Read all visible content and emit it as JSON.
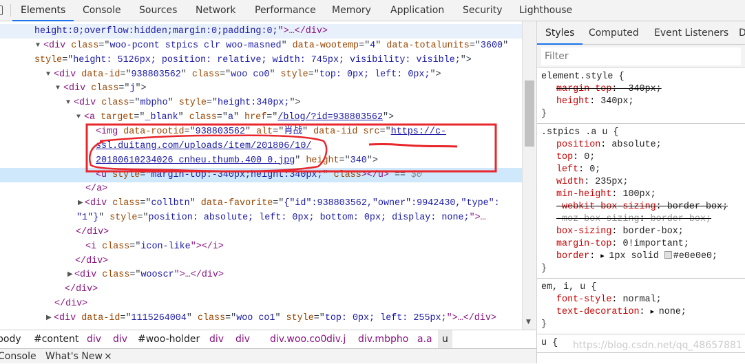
{
  "toolbar": {
    "tabs": [
      "Elements",
      "Console",
      "Sources",
      "Network",
      "Performance",
      "Memory",
      "Application",
      "Security",
      "Lighthouse"
    ],
    "active": "Elements"
  },
  "dom_lines": [
    {
      "tokens": [
        [
          "v",
          "height:0;overflow:hidden;margin:0;padding:0;"
        ],
        [
          "t",
          "\">…</div>"
        ]
      ]
    },
    {
      "tokens": [
        [
          "t",
          "<div "
        ],
        [
          "a",
          "class"
        ],
        [
          "p",
          "=\""
        ],
        [
          "v",
          "woo-pcont stpics clr woo-masned"
        ],
        [
          "p",
          "\" "
        ],
        [
          "a",
          "data-wootemp"
        ],
        [
          "p",
          "=\""
        ],
        [
          "v",
          "4"
        ],
        [
          "p",
          "\" "
        ],
        [
          "a",
          "data-totalunits"
        ],
        [
          "p",
          "=\""
        ],
        [
          "v",
          "3600"
        ],
        [
          "p",
          "\""
        ]
      ]
    },
    {
      "tokens": [
        [
          "a",
          "style"
        ],
        [
          "p",
          "=\""
        ],
        [
          "v",
          "height: 5126px; position: relative; width: 745px; visibility: visible;"
        ],
        [
          "p",
          "\">"
        ]
      ]
    },
    {
      "tokens": [
        [
          "t",
          "<div "
        ],
        [
          "a",
          "data-id"
        ],
        [
          "p",
          "=\""
        ],
        [
          "v",
          "938803562"
        ],
        [
          "p",
          "\" "
        ],
        [
          "a",
          "class"
        ],
        [
          "p",
          "=\""
        ],
        [
          "v",
          "woo co0"
        ],
        [
          "p",
          "\" "
        ],
        [
          "a",
          "style"
        ],
        [
          "p",
          "=\""
        ],
        [
          "v",
          "top: 0px; left: 0px;"
        ],
        [
          "p",
          "\">"
        ]
      ]
    },
    {
      "tokens": [
        [
          "t",
          "<div "
        ],
        [
          "a",
          "class"
        ],
        [
          "p",
          "=\""
        ],
        [
          "v",
          "j"
        ],
        [
          "p",
          "\">"
        ]
      ]
    },
    {
      "tokens": [
        [
          "t",
          "<div "
        ],
        [
          "a",
          "class"
        ],
        [
          "p",
          "=\""
        ],
        [
          "v",
          "mbpho"
        ],
        [
          "p",
          "\" "
        ],
        [
          "a",
          "style"
        ],
        [
          "p",
          "=\""
        ],
        [
          "v",
          "height:340px;"
        ],
        [
          "p",
          "\">"
        ]
      ]
    },
    {
      "tokens": [
        [
          "t",
          "<a "
        ],
        [
          "a",
          "target"
        ],
        [
          "p",
          "=\""
        ],
        [
          "v",
          "_blank"
        ],
        [
          "p",
          "\" "
        ],
        [
          "a",
          "class"
        ],
        [
          "p",
          "=\""
        ],
        [
          "v",
          "a"
        ],
        [
          "p",
          "\" "
        ],
        [
          "a",
          "href"
        ],
        [
          "p",
          "=\""
        ],
        [
          "l",
          "/blog/?id=938803562"
        ],
        [
          "p",
          "\">"
        ]
      ]
    },
    {
      "tokens": [
        [
          "t",
          "<img "
        ],
        [
          "a",
          "data-rootid"
        ],
        [
          "p",
          "=\""
        ],
        [
          "v",
          "938803562"
        ],
        [
          "p",
          "\" "
        ],
        [
          "a",
          "alt"
        ],
        [
          "p",
          "=\""
        ],
        [
          "v",
          "肖战"
        ],
        [
          "p",
          "\" "
        ],
        [
          "a",
          "data-iid"
        ],
        [
          "p",
          " "
        ],
        [
          "a",
          "src"
        ],
        [
          "p",
          "=\""
        ],
        [
          "l",
          "https://c-"
        ]
      ]
    },
    {
      "tokens": [
        [
          "l",
          "ssl.duitang.com/uploads/item/201806/10/"
        ]
      ]
    },
    {
      "tokens": [
        [
          "l",
          "20180610234026_cnheu.thumb.400_0.jpg"
        ],
        [
          "p",
          "\" "
        ],
        [
          "a",
          "height"
        ],
        [
          "p",
          "=\""
        ],
        [
          "v",
          "340"
        ],
        [
          "p",
          "\">"
        ]
      ]
    },
    {
      "tokens": [
        [
          "t",
          "<u "
        ],
        [
          "a",
          "style"
        ],
        [
          "p",
          "=\""
        ],
        [
          "v",
          "margin-top:-340px;height:340px;"
        ],
        [
          "p",
          "\" "
        ],
        [
          "a",
          "class"
        ],
        [
          "t",
          "></u>"
        ],
        [
          "p",
          " == "
        ],
        [
          "g",
          "$0"
        ]
      ]
    },
    {
      "tokens": [
        [
          "t",
          "</a>"
        ]
      ]
    },
    {
      "tokens": [
        [
          "t",
          "<div "
        ],
        [
          "a",
          "class"
        ],
        [
          "p",
          "=\""
        ],
        [
          "v",
          "collbtn"
        ],
        [
          "p",
          "\" "
        ],
        [
          "a",
          "data-favorite"
        ],
        [
          "p",
          "=\""
        ],
        [
          "v",
          "{\"id\":938803562,\"owner\":9942430,\"type\":"
        ]
      ]
    },
    {
      "tokens": [
        [
          "v",
          "\"1\"}"
        ],
        [
          "p",
          "\" "
        ],
        [
          "a",
          "style"
        ],
        [
          "p",
          "=\""
        ],
        [
          "v",
          "position: absolute; left: 0px; bottom: 0px; display: none;"
        ],
        [
          "t",
          "\">…"
        ]
      ]
    },
    {
      "tokens": [
        [
          "t",
          "</div>"
        ]
      ]
    },
    {
      "tokens": [
        [
          "t",
          "<i "
        ],
        [
          "a",
          "class"
        ],
        [
          "p",
          "=\""
        ],
        [
          "v",
          "icon-like"
        ],
        [
          "t",
          "\"></i>"
        ]
      ]
    },
    {
      "tokens": [
        [
          "t",
          "</div>"
        ]
      ]
    },
    {
      "tokens": [
        [
          "t",
          "<div "
        ],
        [
          "a",
          "class"
        ],
        [
          "p",
          "=\""
        ],
        [
          "v",
          "wooscr"
        ],
        [
          "t",
          "\">…</div>"
        ]
      ]
    },
    {
      "tokens": [
        [
          "t",
          "</div>"
        ]
      ]
    },
    {
      "tokens": [
        [
          "t",
          "</div>"
        ]
      ]
    },
    {
      "tokens": [
        [
          "t",
          "<div "
        ],
        [
          "a",
          "data-id"
        ],
        [
          "p",
          "=\""
        ],
        [
          "v",
          "1115264004"
        ],
        [
          "p",
          "\" "
        ],
        [
          "a",
          "class"
        ],
        [
          "p",
          "=\""
        ],
        [
          "v",
          "woo co1"
        ],
        [
          "p",
          "\" "
        ],
        [
          "a",
          "style"
        ],
        [
          "p",
          "=\""
        ],
        [
          "v",
          "top: 0px; left: 255px;"
        ],
        [
          "t",
          "\">…</div>"
        ]
      ]
    }
  ],
  "breadcrumb": [
    "body",
    "#content",
    "div",
    "div",
    "#woo-holder",
    "div",
    "div",
    "div.woo.co0",
    "div.j",
    "div.mbpho",
    "a.a",
    "u"
  ],
  "drawer": {
    "tabs": [
      "Console",
      "What's New"
    ],
    "close": "×"
  },
  "sidebar": {
    "tabs": [
      "Styles",
      "Computed",
      "Event Listeners",
      "D"
    ],
    "filter_placeholder": "Filter",
    "rules": [
      {
        "selector": "element.style {",
        "decls": [
          {
            "prop": "margin-top",
            "val": "-340px;",
            "struck": true
          },
          {
            "prop": "height",
            "val": "340px;"
          }
        ]
      },
      {
        "selector": ".stpics .a u {",
        "decls": [
          {
            "prop": "position",
            "val": "absolute;"
          },
          {
            "prop": "top",
            "val": "0;"
          },
          {
            "prop": "left",
            "val": "0;"
          },
          {
            "prop": "width",
            "val": "235px;"
          },
          {
            "prop": "min-height",
            "val": "100px;"
          },
          {
            "prop": "-webkit-box-sizing",
            "val": "border-box;",
            "struck": true
          },
          {
            "prop": "-moz-box-sizing",
            "val": "border-box;",
            "struck": true,
            "dim": true
          },
          {
            "prop": "box-sizing",
            "val": "border-box;"
          },
          {
            "prop": "margin-top",
            "val": "0!important;"
          },
          {
            "prop": "border",
            "val": "1px solid",
            "expand": true,
            "swatch": "#e0e0e0",
            "after": "#e0e0e0;"
          }
        ]
      },
      {
        "selector": "em, i, u {",
        "decls": [
          {
            "prop": "font-style",
            "val": "normal;"
          },
          {
            "prop": "text-decoration",
            "val": "none;",
            "expand": true
          }
        ]
      },
      {
        "selector": "u {",
        "decls": []
      }
    ],
    "close_brace": "}"
  },
  "watermark": "https://blog.csdn.net/qq_48657881",
  "colors": {
    "accent": "#1a73e8",
    "annotation": "#e8262b",
    "selected_row": "#cfe8fc"
  }
}
